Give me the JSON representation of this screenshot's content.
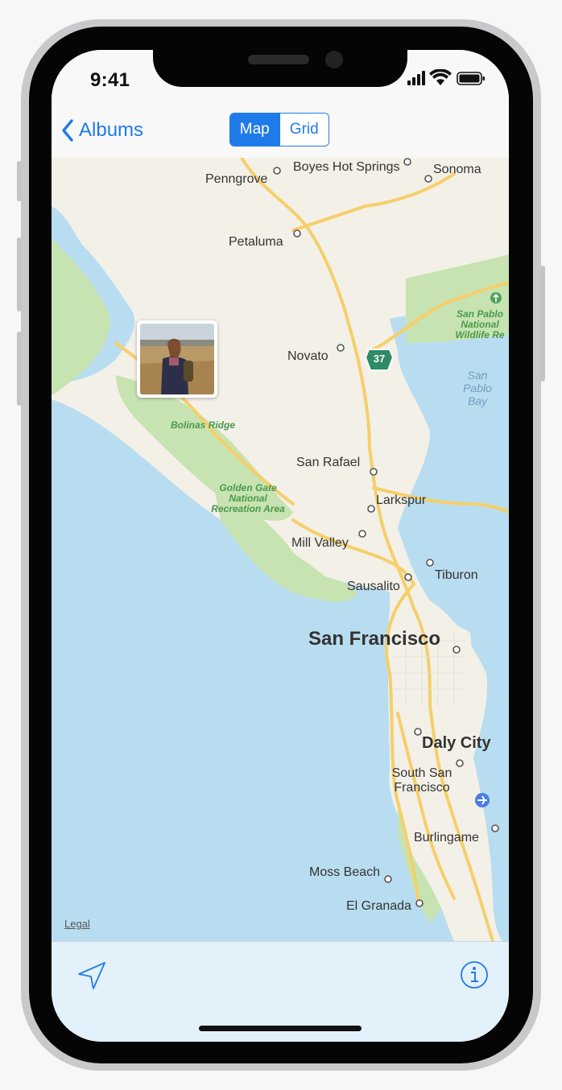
{
  "status": {
    "time": "9:41"
  },
  "nav": {
    "back_label": "Albums",
    "segments": [
      {
        "label": "Map",
        "selected": true
      },
      {
        "label": "Grid",
        "selected": false
      }
    ]
  },
  "map": {
    "places": {
      "penngrove": "Penngrove",
      "boyes": "Boyes Hot Springs",
      "sonoma": "Sonoma",
      "petaluma": "Petaluma",
      "novato": "Novato",
      "san_rafael": "San Rafael",
      "larkspur": "Larkspur",
      "mill_valley": "Mill Valley",
      "sausalito": "Sausalito",
      "tiburon": "Tiburon",
      "san_francisco": "San Francisco",
      "daly_city": "Daly City",
      "south_sf": "South San Francisco",
      "burlingame": "Burlingame",
      "moss_beach": "Moss Beach",
      "el_granada": "El Granada"
    },
    "parks": {
      "bolinas": "Bolinas Ridge",
      "ggnra": "Golden Gate National Recreation Area",
      "san_pablo": "San Pablo National Wildlife Re"
    },
    "water": {
      "san_pablo_bay": "San Pablo Bay"
    },
    "highway_shield": "37",
    "legal_label": "Legal"
  },
  "toolbar": {
    "location_icon": "location-arrow-icon",
    "info_icon": "info-icon"
  },
  "colors": {
    "accent": "#1f7bea",
    "water": "#b9ddf0",
    "land": "#f3f0e8",
    "park": "#c7e3b1",
    "road": "#f5cf6a"
  }
}
